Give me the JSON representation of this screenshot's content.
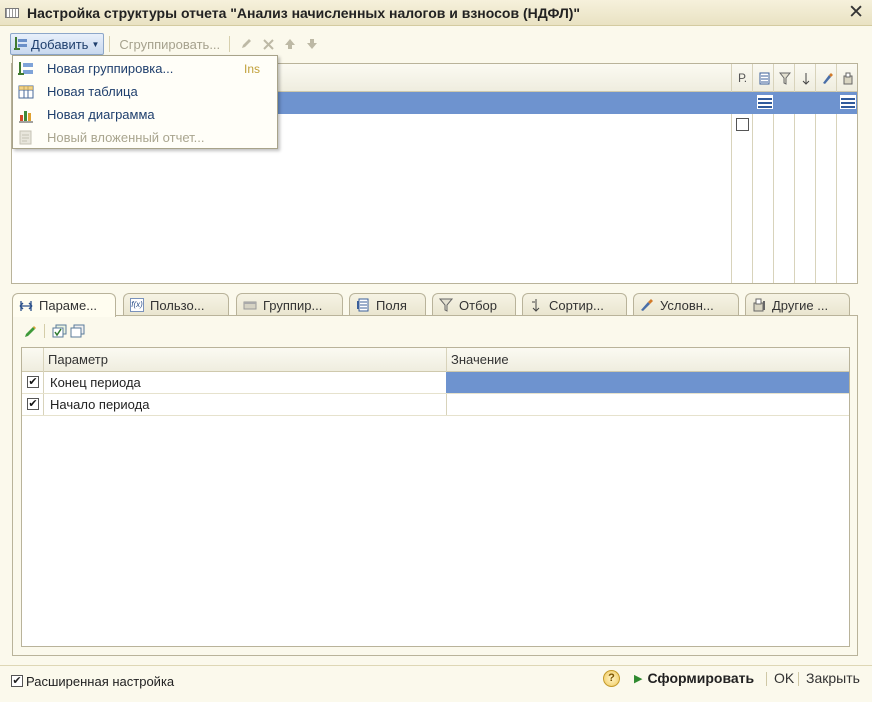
{
  "window": {
    "title": "Настройка структуры отчета \"Анализ начисленных налогов и взносов (НДФЛ)\""
  },
  "toolbar": {
    "add_label": "Добавить",
    "group_label": "Сгруппировать..."
  },
  "add_menu": {
    "items": [
      {
        "label": "Новая группировка...",
        "shortcut": "Ins",
        "icon": "grouping-icon",
        "enabled": true
      },
      {
        "label": "Новая таблица",
        "shortcut": "",
        "icon": "table-icon",
        "enabled": true
      },
      {
        "label": "Новая диаграмма",
        "shortcut": "",
        "icon": "chart-icon",
        "enabled": true
      },
      {
        "label": "Новый вложенный отчет...",
        "shortcut": "",
        "icon": "nested-report-icon",
        "enabled": false
      }
    ]
  },
  "structure": {
    "col_r_label": "Р."
  },
  "tabs": [
    {
      "label": "Параме...",
      "icon": "parameters-icon",
      "active": true
    },
    {
      "label": "Пользо...",
      "icon": "user-fields-icon",
      "active": false
    },
    {
      "label": "Группир...",
      "icon": "grouping-fields-icon",
      "active": false
    },
    {
      "label": "Поля",
      "icon": "fields-icon",
      "active": false
    },
    {
      "label": "Отбор",
      "icon": "filter-icon",
      "active": false
    },
    {
      "label": "Сортир...",
      "icon": "sort-icon",
      "active": false
    },
    {
      "label": "Условн...",
      "icon": "conditional-format-icon",
      "active": false
    },
    {
      "label": "Другие ...",
      "icon": "other-settings-icon",
      "active": false
    }
  ],
  "params_table": {
    "columns": [
      "Параметр",
      "Значение"
    ],
    "rows": [
      {
        "checked": true,
        "name": "Конец периода",
        "value": ""
      },
      {
        "checked": true,
        "name": "Начало периода",
        "value": ""
      }
    ]
  },
  "footer": {
    "advanced_label": "Расширенная настройка",
    "advanced_checked": true,
    "help_label": "?",
    "run_label": "Сформировать",
    "ok_label": "OK",
    "close_label": "Закрыть"
  },
  "colors": {
    "selection": "#6e93cf",
    "link": "#1f3f6d",
    "background": "#fbf9ec"
  }
}
